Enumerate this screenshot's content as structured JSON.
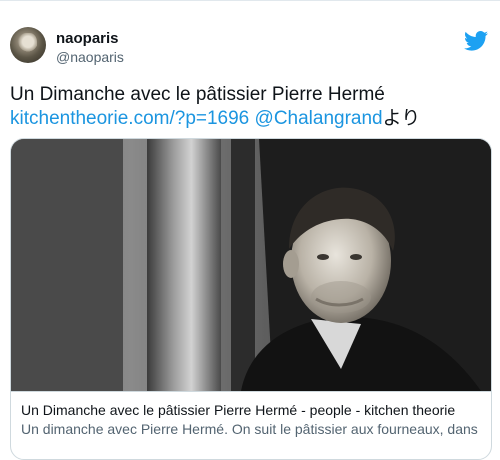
{
  "account": {
    "display_name": "naoparis",
    "handle": "@naoparis",
    "brand_color": "#1da1f2"
  },
  "tweet": {
    "line1": "Un Dimanche avec le pâtissier Pierre Hermé",
    "link_url": "kitchentheorie.com/?p=1696",
    "mention": "@Chalangrand",
    "suffix": "より",
    "link_color": "#1b95e0"
  },
  "card": {
    "image_icon": "portrait-photo",
    "title": "Un Dimanche avec le pâtissier Pierre Hermé - people - kitchen theorie",
    "description": "Un dimanche avec Pierre Hermé. On suit le pâtissier aux fourneaux, dans"
  }
}
